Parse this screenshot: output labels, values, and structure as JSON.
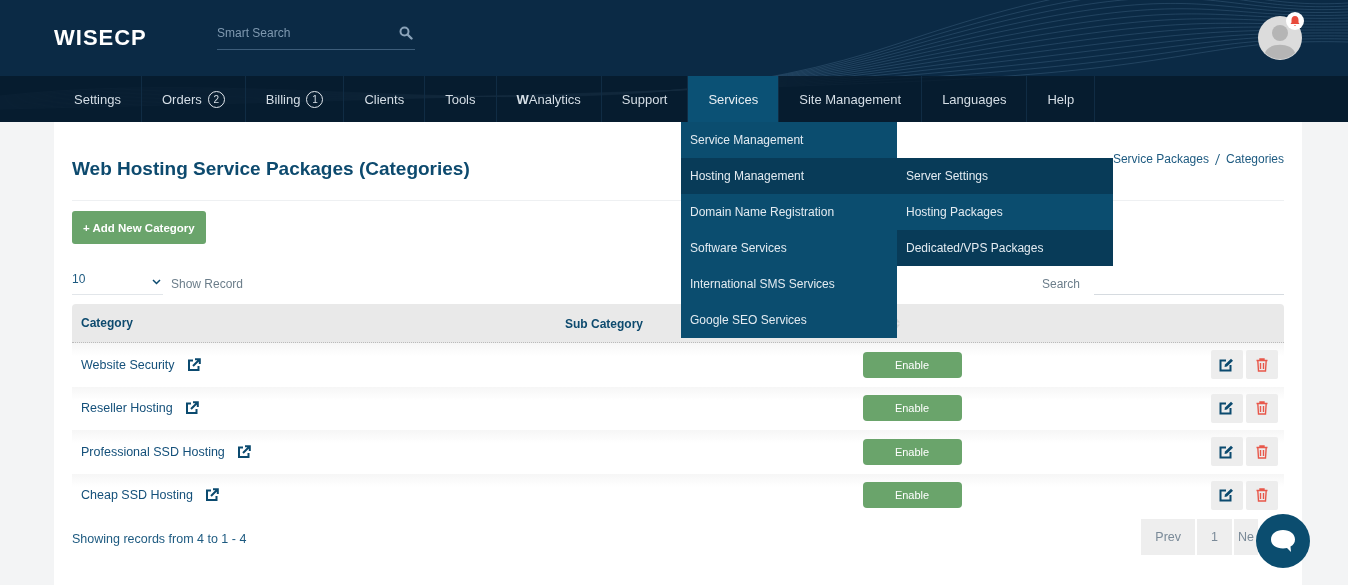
{
  "header": {
    "logo": "WISECP",
    "search": {
      "placeholder": "Smart Search"
    },
    "notification": true
  },
  "nav": [
    {
      "label": "Settings",
      "selected": false
    },
    {
      "label": "Orders",
      "badge": "2",
      "selected": false
    },
    {
      "label": "Billing",
      "badge": "1",
      "selected": false
    },
    {
      "label": "Clients",
      "selected": false
    },
    {
      "label": "Tools",
      "selected": false
    },
    {
      "label": "**W**Analytics",
      "selected": false
    },
    {
      "label": "Support",
      "selected": false
    },
    {
      "label": "Services",
      "selected": true
    },
    {
      "label": "Site Management",
      "selected": false
    },
    {
      "label": "Languages",
      "selected": false
    },
    {
      "label": "Help",
      "selected": false
    }
  ],
  "dropdown": [
    {
      "label": "Service Management",
      "selected": false
    },
    {
      "label": "Hosting Management",
      "selected": true,
      "children": [
        {
          "label": "Server Settings",
          "selected": true
        },
        {
          "label": "Hosting Packages",
          "selected": false
        },
        {
          "label": "Dedicated/VPS Packages",
          "selected": true
        }
      ]
    },
    {
      "label": "Domain Name Registration",
      "selected": false
    },
    {
      "label": "Software Services",
      "selected": false
    },
    {
      "label": "International SMS Services",
      "selected": false
    },
    {
      "label": "Google SEO Services",
      "selected": false
    }
  ],
  "page": {
    "title": "Web Hosting Service Packages (Categories)",
    "breadcrumb": [
      "Service Packages",
      "Categories"
    ],
    "add_button": "+ Add New Category"
  },
  "table_controls": {
    "page_size": "10",
    "page_size_label": "Show Record",
    "search_label": "Search"
  },
  "table": {
    "columns": [
      "Category",
      "Sub Category"
    ],
    "rows": [
      {
        "category": "Website Security",
        "status": "Enable"
      },
      {
        "category": "Reseller Hosting",
        "status": "Enable"
      },
      {
        "category": "Professional SSD Hosting",
        "status": "Enable"
      },
      {
        "category": "Cheap SSD Hosting",
        "status": "Enable"
      }
    ]
  },
  "footer": {
    "summary": "Showing records from 4 to 1 - 4",
    "pagination": [
      "Prev",
      "1",
      "Ne"
    ]
  }
}
